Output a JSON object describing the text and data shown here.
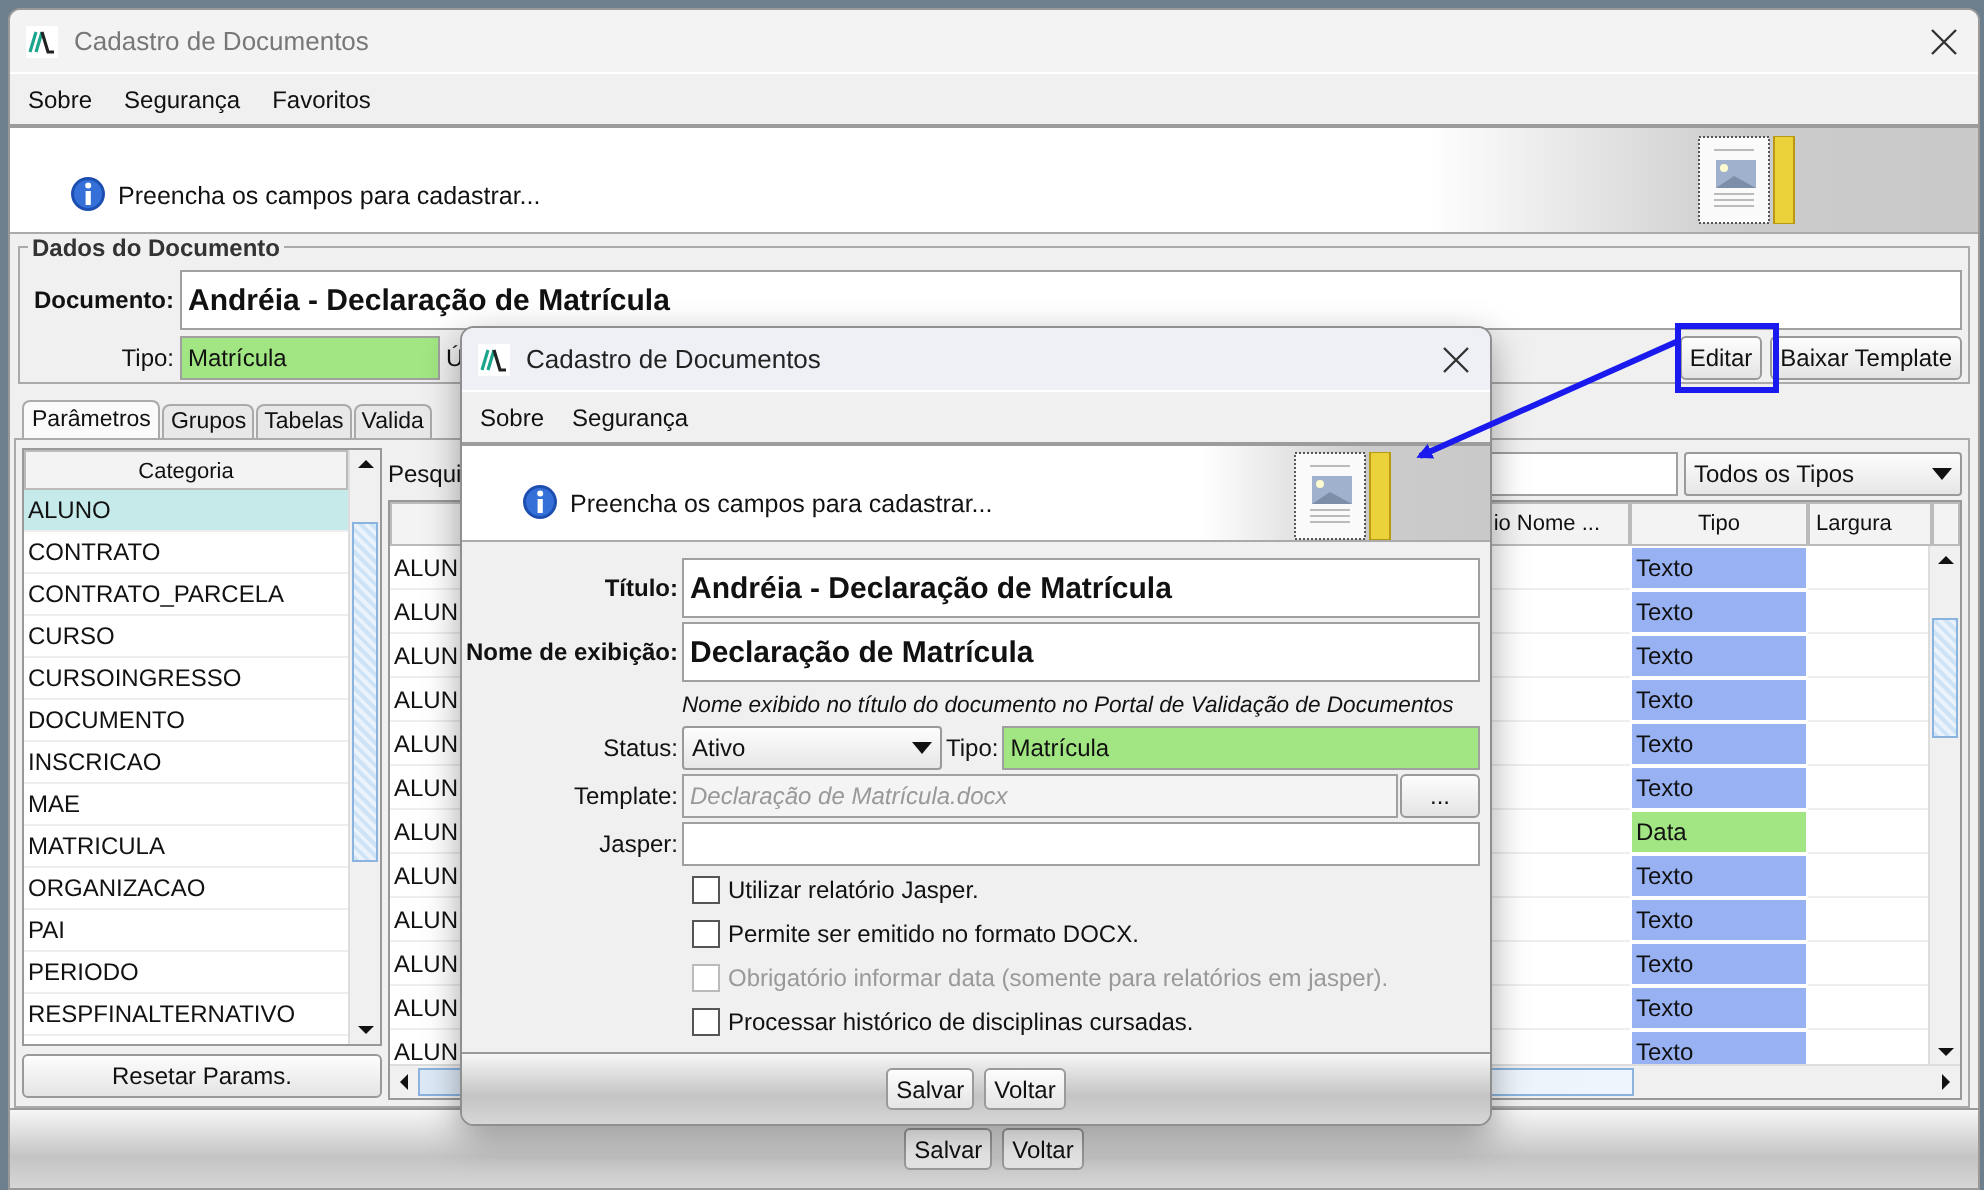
{
  "window": {
    "title": "Cadastro de Documentos"
  },
  "menu": [
    "Sobre",
    "Segurança",
    "Favoritos"
  ],
  "banner": {
    "message": "Preencha os campos para cadastrar..."
  },
  "document_group": {
    "legend": "Dados do Documento",
    "document_label": "Documento:",
    "document_value": "Andréia - Declaração de Matrícula",
    "tipo_label": "Tipo:",
    "tipo_value": "Matrícula",
    "next_label": "Ú",
    "buttons": [
      "Editar",
      "Baixar Template"
    ]
  },
  "tabs": [
    {
      "label": "Parâmetros",
      "selected": true
    },
    {
      "label": "Grupos",
      "selected": false
    },
    {
      "label": "Tabelas",
      "selected": false
    },
    {
      "label": "Valida",
      "selected": false
    }
  ],
  "categories": {
    "header": "Categoria",
    "items": [
      {
        "label": "ALUNO",
        "selected": true
      },
      {
        "label": "CONTRATO",
        "selected": false
      },
      {
        "label": "CONTRATO_PARCELA",
        "selected": false
      },
      {
        "label": "CURSO",
        "selected": false
      },
      {
        "label": "CURSOINGRESSO",
        "selected": false
      },
      {
        "label": "DOCUMENTO",
        "selected": false
      },
      {
        "label": "INSCRICAO",
        "selected": false
      },
      {
        "label": "MAE",
        "selected": false
      },
      {
        "label": "MATRICULA",
        "selected": false
      },
      {
        "label": "ORGANIZACAO",
        "selected": false
      },
      {
        "label": "PAI",
        "selected": false
      },
      {
        "label": "PERIODO",
        "selected": false
      },
      {
        "label": "RESPFINALTERNATIVO",
        "selected": false
      }
    ],
    "reset_button": "Resetar Params."
  },
  "search": {
    "label": "Pesqui",
    "filter": "Todos os Tipos"
  },
  "table": {
    "columns": [
      "io Nome ...",
      "Tipo",
      "Largura"
    ],
    "rows": [
      {
        "column_1": "ALUN",
        "tipo": "Texto",
        "color": "#97b1f3"
      },
      {
        "column_1": "ALUN",
        "tipo": "Texto",
        "color": "#97b1f3"
      },
      {
        "column_1": "ALUN",
        "tipo": "Texto",
        "color": "#97b1f3"
      },
      {
        "column_1": "ALUN",
        "tipo": "Texto",
        "color": "#97b1f3"
      },
      {
        "column_1": "ALUN",
        "tipo": "Texto",
        "color": "#97b1f3"
      },
      {
        "column_1": "ALUN",
        "tipo": "Texto",
        "color": "#97b1f3"
      },
      {
        "column_1": "ALUN",
        "tipo": "Data",
        "color": "#a1e682"
      },
      {
        "column_1": "ALUN",
        "tipo": "Texto",
        "color": "#97b1f3"
      },
      {
        "column_1": "ALUN",
        "tipo": "Texto",
        "color": "#97b1f3"
      },
      {
        "column_1": "ALUN",
        "tipo": "Texto",
        "color": "#97b1f3"
      },
      {
        "column_1": "ALUN",
        "tipo": "Texto",
        "color": "#97b1f3"
      },
      {
        "column_1": "ALUN",
        "tipo": "Texto",
        "color": "#97b1f3"
      }
    ]
  },
  "footer_buttons": [
    "Salvar",
    "Voltar"
  ],
  "dialog": {
    "title": "Cadastro de Documentos",
    "menu": [
      "Sobre",
      "Segurança"
    ],
    "message": "Preencha os campos para cadastrar...",
    "titulo_label": "Título:",
    "titulo_value": "Andréia - Declaração de Matrícula",
    "nome_label": "Nome de exibição:",
    "nome_value": "Declaração de Matrícula",
    "hint": "Nome exibido no título do documento no Portal de Validação de Documentos",
    "status_label": "Status:",
    "status_value": "Ativo",
    "tipo_label": "Tipo:",
    "tipo_value": "Matrícula",
    "template_label": "Template:",
    "template_value": "Declaração de Matrícula.docx",
    "template_button": "...",
    "jasper_label": "Jasper:",
    "checkboxes": [
      {
        "label": "Utilizar relatório Jasper.",
        "checked": false,
        "disabled": false
      },
      {
        "label": "Permite ser emitido no formato DOCX.",
        "checked": false,
        "disabled": false
      },
      {
        "label": "Obrigatório informar data (somente para relatórios em jasper).",
        "checked": false,
        "disabled": true
      },
      {
        "label": "Processar histórico de disciplinas cursadas.",
        "checked": false,
        "disabled": false
      }
    ],
    "buttons": [
      "Salvar",
      "Voltar"
    ]
  }
}
